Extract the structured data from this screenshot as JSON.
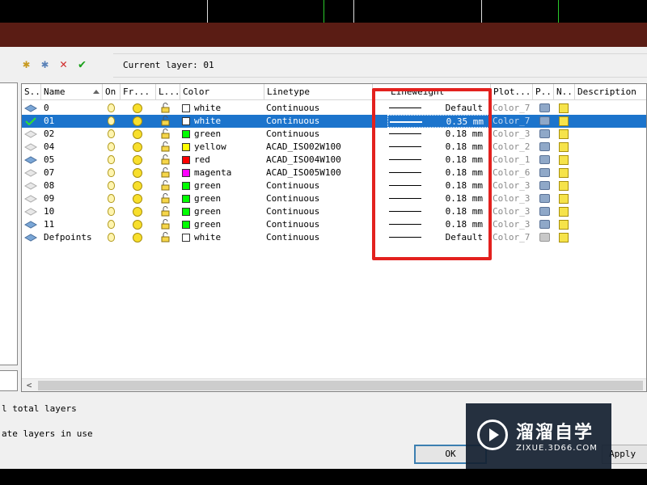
{
  "dialog": {
    "toolbar": {
      "new_layer": "new-layer-icon",
      "new_vp_frozen": "new-layer-vp-frozen-icon",
      "delete": "delete-layer-icon",
      "set_current": "set-current-icon"
    },
    "current_layer_label": "Current layer: 01"
  },
  "columns": [
    "S..",
    "Name",
    "On",
    "Fr...",
    "L...",
    "Color",
    "Linetype",
    "Lineweight",
    "Plot...",
    "P..",
    "N..",
    "Description"
  ],
  "layers": [
    {
      "name": "0",
      "color_name": "white",
      "color_hex": "#ffffff",
      "linetype": "Continuous",
      "lineweight": "Default",
      "plot_style": "Color_7"
    },
    {
      "name": "01",
      "color_name": "white",
      "color_hex": "#ffffff",
      "linetype": "Continuous",
      "lineweight": "0.35 mm",
      "plot_style": "Color_7"
    },
    {
      "name": "02",
      "color_name": "green",
      "color_hex": "#00ff00",
      "linetype": "Continuous",
      "lineweight": "0.18 mm",
      "plot_style": "Color_3"
    },
    {
      "name": "04",
      "color_name": "yellow",
      "color_hex": "#ffff00",
      "linetype": "ACAD_ISO02W100",
      "lineweight": "0.18 mm",
      "plot_style": "Color_2"
    },
    {
      "name": "05",
      "color_name": "red",
      "color_hex": "#ff0000",
      "linetype": "ACAD_ISO04W100",
      "lineweight": "0.18 mm",
      "plot_style": "Color_1"
    },
    {
      "name": "07",
      "color_name": "magenta",
      "color_hex": "#ff00ff",
      "linetype": "ACAD_ISO05W100",
      "lineweight": "0.18 mm",
      "plot_style": "Color_6"
    },
    {
      "name": "08",
      "color_name": "green",
      "color_hex": "#00ff00",
      "linetype": "Continuous",
      "lineweight": "0.18 mm",
      "plot_style": "Color_3"
    },
    {
      "name": "09",
      "color_name": "green",
      "color_hex": "#00ff00",
      "linetype": "Continuous",
      "lineweight": "0.18 mm",
      "plot_style": "Color_3"
    },
    {
      "name": "10",
      "color_name": "green",
      "color_hex": "#00ff00",
      "linetype": "Continuous",
      "lineweight": "0.18 mm",
      "plot_style": "Color_3"
    },
    {
      "name": "11",
      "color_name": "green",
      "color_hex": "#00ff00",
      "linetype": "Continuous",
      "lineweight": "0.18 mm",
      "plot_style": "Color_3"
    },
    {
      "name": "Defpoints",
      "color_name": "white",
      "color_hex": "#ffffff",
      "linetype": "Continuous",
      "lineweight": "Default",
      "plot_style": "Color_7"
    }
  ],
  "status": {
    "total_layers": "l total layers",
    "layers_in_use": "ate layers in use"
  },
  "buttons": {
    "ok": "OK",
    "apply": "Apply"
  },
  "watermark": {
    "name": "溜溜自学",
    "url": "ZIXUE.3D66.COM"
  },
  "colors": {
    "selection": "#1c74cc",
    "highlight_box": "#e3211e",
    "title_bar": "#5a1c14"
  }
}
